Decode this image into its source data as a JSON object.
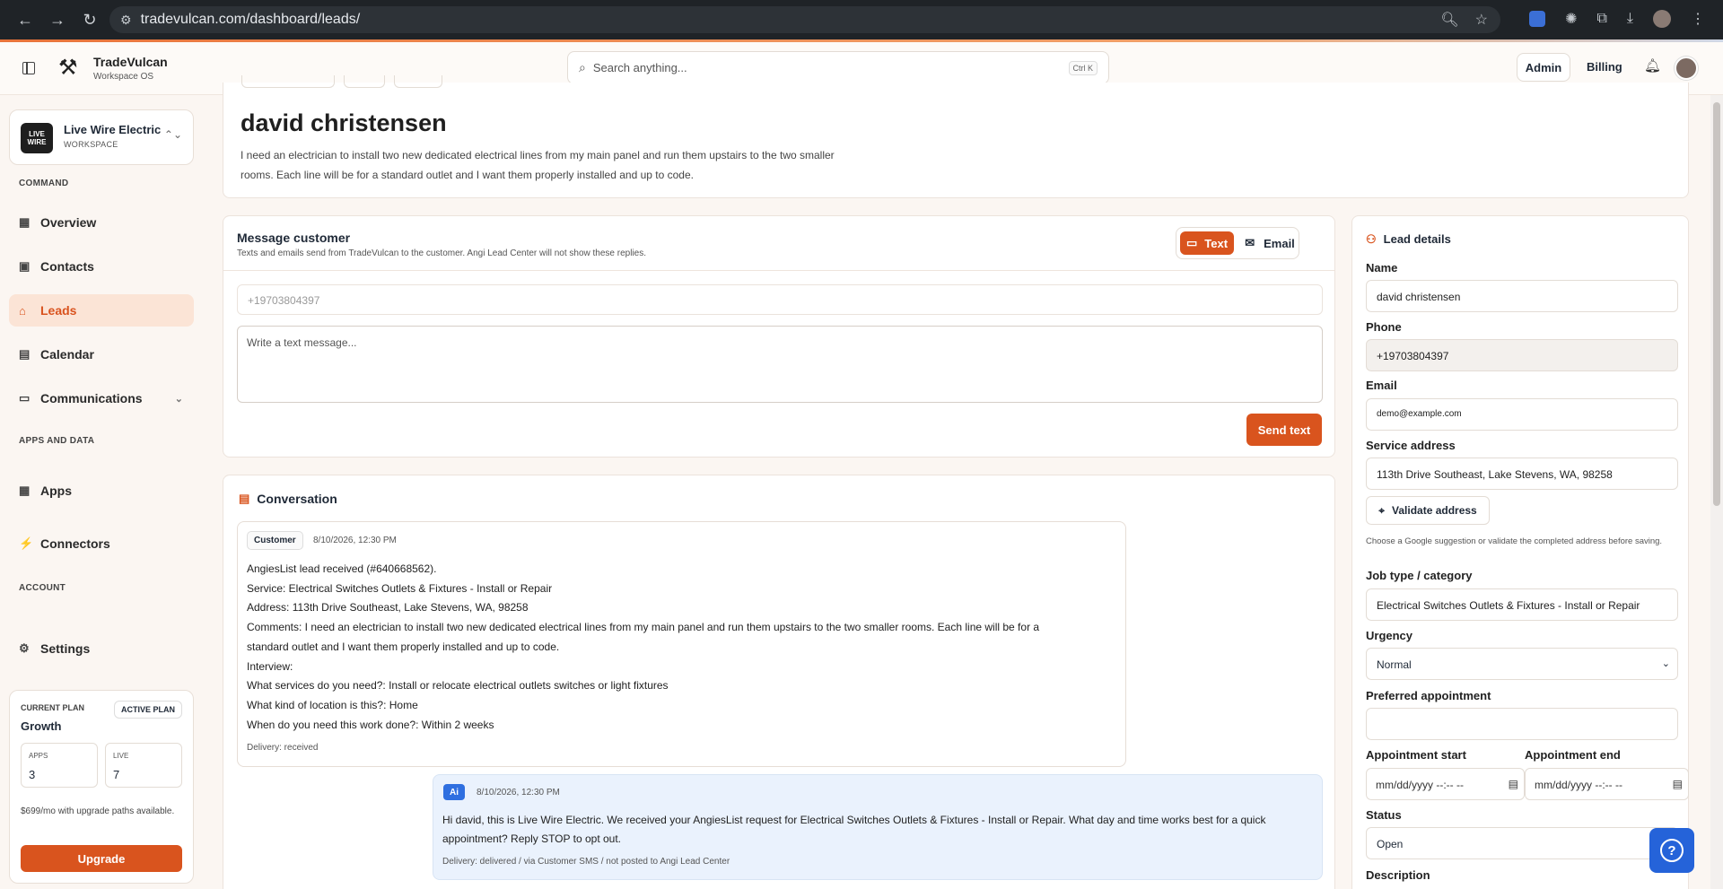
{
  "browser": {
    "url": "tradevulcan.com/dashboard/leads/"
  },
  "brand": {
    "name": "TradeVulcan",
    "sub": "Workspace OS"
  },
  "search": {
    "placeholder": "Search anything...",
    "shortcut": "Ctrl K"
  },
  "topnav": {
    "admin": "Admin",
    "billing": "Billing"
  },
  "workspace": {
    "logo": "LIVE WIRE",
    "name": "Live Wire Electric",
    "sub": "WORKSPACE"
  },
  "sidebar": {
    "command_label": "COMMAND",
    "apps_label": "APPS AND DATA",
    "account_label": "ACCOUNT",
    "items": [
      {
        "label": "Overview",
        "icon": "grid-icon"
      },
      {
        "label": "Contacts",
        "icon": "contact-icon"
      },
      {
        "label": "Leads",
        "icon": "inbox-icon"
      },
      {
        "label": "Calendar",
        "icon": "calendar-icon"
      },
      {
        "label": "Communications",
        "icon": "chat-icon"
      },
      {
        "label": "Apps",
        "icon": "table-icon"
      },
      {
        "label": "Connectors",
        "icon": "plug-icon"
      },
      {
        "label": "Settings",
        "icon": "gear-icon"
      }
    ]
  },
  "plan": {
    "label": "CURRENT PLAN",
    "name": "Growth",
    "badge": "ACTIVE PLAN",
    "apps_label": "APPS",
    "apps_value": "3",
    "live_label": "LIVE",
    "live_value": "7",
    "price": "$699/mo with upgrade paths available.",
    "upgrade": "Upgrade"
  },
  "lead": {
    "name": "david christensen",
    "description": "I need an electrician to install two new dedicated electrical lines from my main panel and run them upstairs to the two smaller rooms. Each line will be for a standard outlet and I want them properly installed and up to code."
  },
  "message": {
    "title": "Message customer",
    "subtitle": "Texts and emails send from TradeVulcan to the customer. Angi Lead Center will not show these replies.",
    "tab_text": "Text",
    "tab_email": "Email",
    "phone_placeholder": "+19703804397",
    "text_placeholder": "Write a text message...",
    "send": "Send text"
  },
  "conversation": {
    "title": "Conversation",
    "messages": [
      {
        "sender": "Customer",
        "time": "8/10/2026, 12:30 PM",
        "lines": [
          "AngiesList lead received (#640668562).",
          "Service: Electrical Switches Outlets & Fixtures - Install or Repair",
          "Address: 113th Drive Southeast, Lake Stevens, WA, 98258",
          "Comments: I need an electrician to install two new dedicated electrical lines from my main panel and run them upstairs to the two smaller rooms. Each line will be for a",
          "standard outlet and I want them properly installed and up to code.",
          "Interview:",
          "What services do you need?: Install or relocate electrical outlets switches or light fixtures",
          "What kind of location is this?: Home",
          "When do you need this work done?: Within 2 weeks"
        ],
        "delivery": "Delivery: received"
      },
      {
        "sender": "Ai",
        "time": "8/10/2026, 12:30 PM",
        "lines": [
          "Hi david, this is Live Wire Electric. We received your AngiesList request for Electrical Switches Outlets & Fixtures - Install or Repair. What day and time works best for a quick",
          "appointment? Reply STOP to opt out."
        ],
        "delivery": "Delivery: delivered / via Customer SMS / not posted to Angi Lead Center"
      }
    ]
  },
  "details": {
    "title": "Lead details",
    "name_label": "Name",
    "name_value": "david christensen",
    "phone_label": "Phone",
    "phone_value": "+19703804397",
    "email_label": "Email",
    "email_value": "demo@example.com",
    "address_label": "Service address",
    "address_value": "113th Drive Southeast, Lake Stevens, WA, 98258",
    "validate": "Validate address",
    "hint": "Choose a Google suggestion or validate the completed address before saving.",
    "job_label": "Job type / category",
    "job_value": "Electrical Switches Outlets & Fixtures - Install or Repair",
    "urgency_label": "Urgency",
    "urgency_value": "Normal",
    "pref_label": "Preferred appointment",
    "pref_value": "",
    "start_label": "Appointment start",
    "start_value": "mm/dd/yyyy --:-- --",
    "end_label": "Appointment end",
    "end_value": "mm/dd/yyyy --:-- --",
    "status_label": "Status",
    "status_value": "Open",
    "description_label": "Description"
  },
  "colors": {
    "accent": "#d9541e",
    "ai_blue": "#2f6fe0",
    "help_blue": "#2563d9"
  }
}
